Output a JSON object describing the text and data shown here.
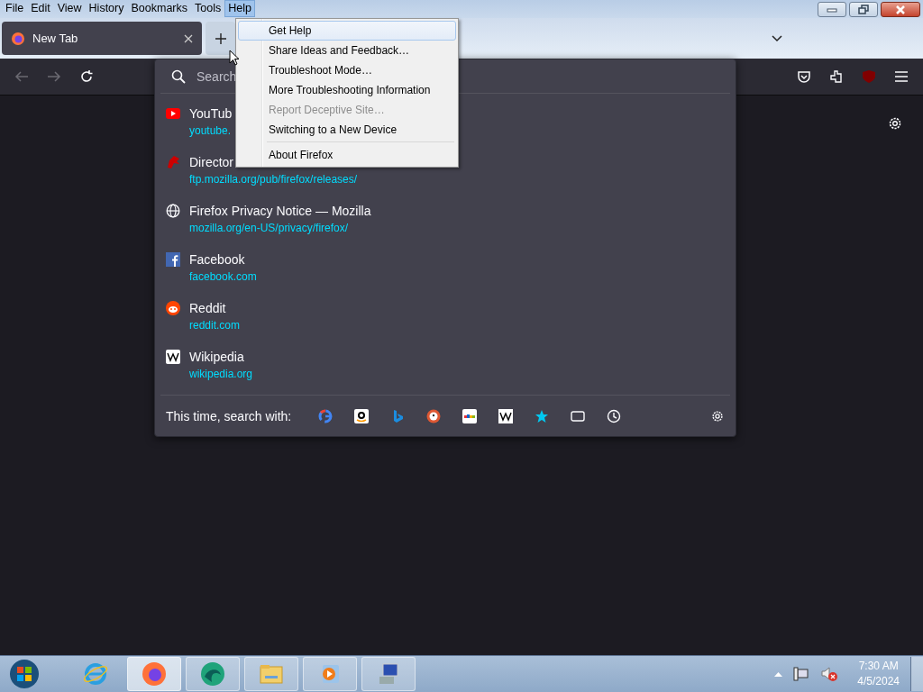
{
  "menubar": [
    {
      "label": "File",
      "selected": false
    },
    {
      "label": "Edit",
      "selected": false
    },
    {
      "label": "View",
      "selected": false
    },
    {
      "label": "History",
      "selected": false
    },
    {
      "label": "Bookmarks",
      "selected": false
    },
    {
      "label": "Tools",
      "selected": false
    },
    {
      "label": "Help",
      "selected": true
    }
  ],
  "tabs": [
    {
      "title": "New Tab",
      "selected": true
    }
  ],
  "url_panel": {
    "placeholder": "Search",
    "results": [
      {
        "kind": "youtube",
        "title": "YouTub",
        "url": "youtube."
      },
      {
        "kind": "bug",
        "title": "Director",
        "url": "ftp.mozilla.org/pub/firefox/releases/"
      },
      {
        "kind": "globe",
        "title": "Firefox Privacy Notice — Mozilla",
        "url": "mozilla.org/en-US/privacy/firefox/"
      },
      {
        "kind": "facebook",
        "title": "Facebook",
        "url": "facebook.com"
      },
      {
        "kind": "reddit",
        "title": "Reddit",
        "url": "reddit.com"
      },
      {
        "kind": "wikipedia",
        "title": "Wikipedia",
        "url": "wikipedia.org"
      }
    ],
    "search_with": {
      "label": "This time, search with:",
      "engines": [
        {
          "kind": "google"
        },
        {
          "kind": "amazon"
        },
        {
          "kind": "bing"
        },
        {
          "kind": "duckduckgo"
        },
        {
          "kind": "ebay"
        },
        {
          "kind": "wikipedia"
        },
        {
          "kind": "bookmarks"
        },
        {
          "kind": "tabs"
        },
        {
          "kind": "history"
        }
      ]
    }
  },
  "help_menu": {
    "items": [
      {
        "kind": "item",
        "label": "Get Help",
        "disabled": false,
        "selected": true
      },
      {
        "kind": "item",
        "label": "Share Ideas and Feedback…",
        "disabled": false,
        "selected": false
      },
      {
        "kind": "item",
        "label": "Troubleshoot Mode…",
        "disabled": false,
        "selected": false
      },
      {
        "kind": "item",
        "label": "More Troubleshooting Information",
        "disabled": false,
        "selected": false
      },
      {
        "kind": "item",
        "label": "Report Deceptive Site…",
        "disabled": true,
        "selected": false
      },
      {
        "kind": "item",
        "label": "Switching to a New Device",
        "disabled": false,
        "selected": false
      },
      {
        "kind": "separator"
      },
      {
        "kind": "item",
        "label": "About Firefox",
        "disabled": false,
        "selected": false
      }
    ]
  },
  "taskbar": {
    "apps": [
      {
        "kind": "ie",
        "selected": false
      },
      {
        "kind": "firefox",
        "selected": true
      },
      {
        "kind": "edge",
        "selected": false
      },
      {
        "kind": "explorer",
        "selected": false
      },
      {
        "kind": "media",
        "selected": false
      },
      {
        "kind": "remote",
        "selected": false
      }
    ],
    "clock": {
      "time": "7:30 AM",
      "date": "4/5/2024"
    }
  }
}
